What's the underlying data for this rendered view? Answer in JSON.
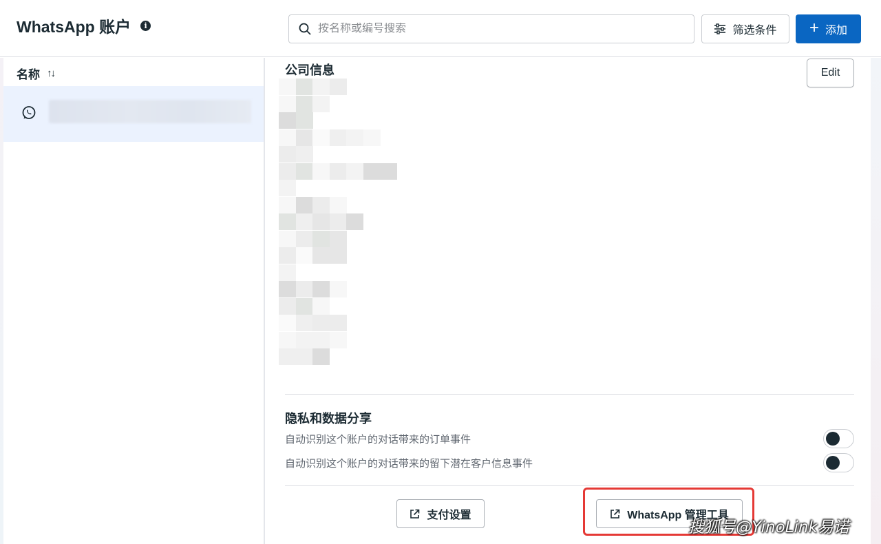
{
  "header": {
    "title": "WhatsApp 账户",
    "info_icon": "i",
    "search_placeholder": "按名称或编号搜索",
    "filter_label": "筛选条件",
    "add_label": "添加",
    "add_icon": "+"
  },
  "sidebar": {
    "column_header": "名称",
    "sort_icon": "↑↓",
    "selected_account": {
      "icon": "whatsapp-icon",
      "name_blurred": true
    }
  },
  "main": {
    "company_section_title": "公司信息",
    "edit_label": "Edit",
    "privacy_section_title": "隐私和数据分享",
    "toggles": [
      {
        "label": "自动识别这个账户的对话带来的订单事件",
        "enabled": false
      },
      {
        "label": "自动识别这个账户的对话带来的留下潜在客户信息事件",
        "enabled": false
      }
    ],
    "footer": {
      "payment_settings_label": "支付设置",
      "wa_manager_label": "WhatsApp 管理工具"
    }
  },
  "watermark": "搜狐号@YinoLink易诺",
  "colors": {
    "primary": "#0a66c2",
    "selected_row": "#ebf2fe",
    "highlight": "#e53935",
    "text": "#1c2b33",
    "muted": "#606770"
  }
}
